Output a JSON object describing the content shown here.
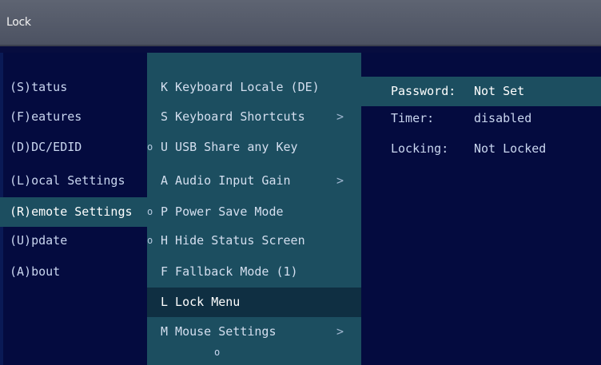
{
  "window": {
    "title": "Lock"
  },
  "main_menu": [
    {
      "label": "(S)tatus",
      "selected": false
    },
    {
      "label": "(F)eatures",
      "selected": false
    },
    {
      "label": "(D)DC/EDID",
      "selected": false
    },
    {
      "label": "(L)ocal  Settings",
      "selected": false
    },
    {
      "label": "(R)emote Settings",
      "selected": true
    },
    {
      "label": "(U)pdate",
      "selected": false
    },
    {
      "label": "(A)bout",
      "selected": false
    }
  ],
  "submenu": [
    {
      "label": "K Keyboard Locale (DE)",
      "dot": "",
      "arrow": ""
    },
    {
      "label": "S Keyboard Shortcuts",
      "dot": "",
      "arrow": ">"
    },
    {
      "label": "U USB Share any Key",
      "dot": "o",
      "arrow": ""
    },
    {
      "label": "A Audio Input Gain",
      "dot": "",
      "arrow": ">"
    },
    {
      "label": "P Power Save Mode",
      "dot": "o",
      "arrow": ""
    },
    {
      "label": "H Hide Status Screen",
      "dot": "o",
      "arrow": ""
    },
    {
      "label": "F Fallback Mode (1)",
      "dot": "",
      "arrow": ""
    },
    {
      "label": "L Lock Menu",
      "dot": "",
      "arrow": "",
      "selected": true
    },
    {
      "label": "M Mouse Settings",
      "dot": "",
      "arrow": ">"
    }
  ],
  "scroll_indicator": "o",
  "lock_info": [
    {
      "key": "Password:",
      "value": "Not Set"
    },
    {
      "key": "Timer:",
      "value": "disabled"
    },
    {
      "key": "Locking:",
      "value": "Not Locked"
    }
  ],
  "colors": {
    "background": "#030a3c",
    "titlebar": "#555b6a",
    "highlight": "#1c4e60",
    "submenu_selected": "#0f2f42",
    "text": "#c9d6ef"
  }
}
